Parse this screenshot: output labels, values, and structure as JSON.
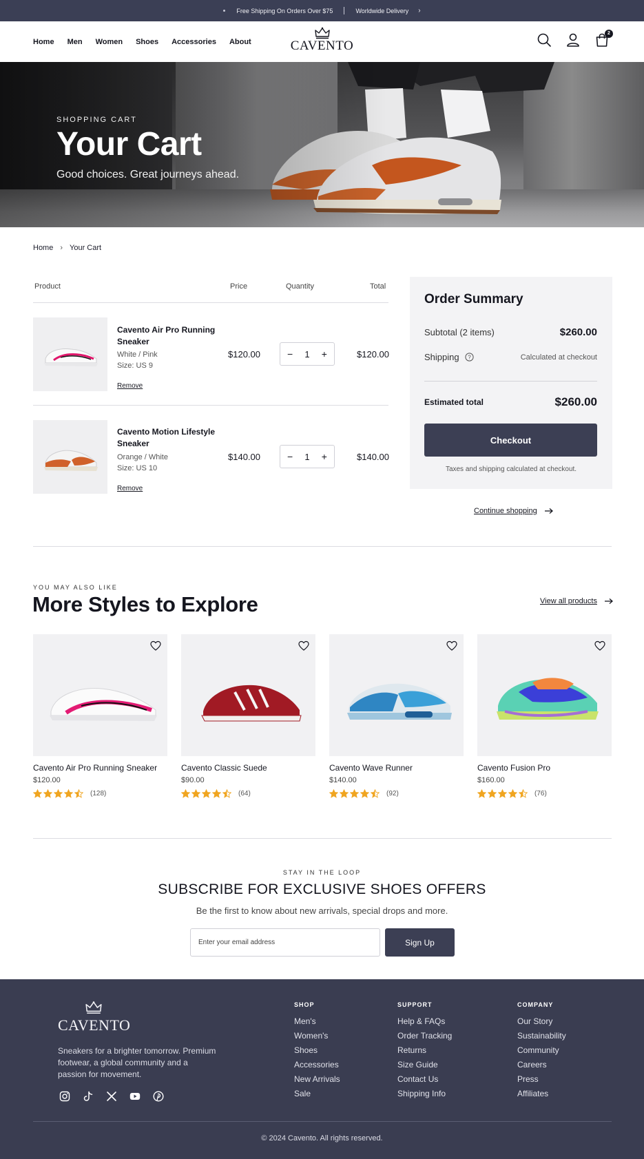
{
  "topbar": {
    "shipping_text": "Free Shipping On Orders Over $75",
    "delivery_text": "Worldwide Delivery"
  },
  "header": {
    "nav": [
      "Home",
      "Men",
      "Women",
      "Shoes",
      "Accessories",
      "About"
    ],
    "brand": "CAVENTO",
    "cart_count": "2",
    "icons": [
      "search-icon",
      "user-icon",
      "bag-icon"
    ]
  },
  "hero": {
    "eyebrow": "SHOPPING CART",
    "title": "Your Cart",
    "subtitle": "Good choices. Great journeys ahead."
  },
  "breadcrumb": {
    "home": "Home",
    "current": "Your Cart"
  },
  "cart": {
    "headers": {
      "product": "Product",
      "price": "Price",
      "quantity": "Quantity",
      "total": "Total"
    },
    "items": [
      {
        "name": "Cavento Air Pro Running Sneaker",
        "color": "White / Pink",
        "size": "Size: US 9",
        "price": "$120.00",
        "qty": "1",
        "total": "$120.00",
        "remove": "Remove"
      },
      {
        "name": "Cavento Motion Lifestyle Sneaker",
        "color": "Orange / White",
        "size": "Size: US 10",
        "price": "$140.00",
        "qty": "1",
        "total": "$140.00",
        "remove": "Remove"
      }
    ]
  },
  "summary": {
    "title": "Order Summary",
    "subtotal_label": "Subtotal (2 items)",
    "subtotal_value": "$260.00",
    "shipping_label": "Shipping",
    "shipping_value": "Calculated at checkout",
    "total_label": "Estimated total",
    "total_value": "$260.00",
    "checkout_label": "Checkout",
    "note": "Taxes and shipping calculated at checkout.",
    "continue_label": "Continue shopping"
  },
  "related": {
    "eyebrow": "YOU MAY ALSO LIKE",
    "title": "More Styles to Explore",
    "view_all": "View all products",
    "products": [
      {
        "name": "Cavento Air Pro Running Sneaker",
        "price": "$120.00",
        "rating": 4.5,
        "count": "(128)"
      },
      {
        "name": "Cavento Classic Suede",
        "price": "$90.00",
        "rating": 4.5,
        "count": "(64)"
      },
      {
        "name": "Cavento Wave Runner",
        "price": "$140.00",
        "rating": 4.5,
        "count": "(92)"
      },
      {
        "name": "Cavento Fusion Pro",
        "price": "$160.00",
        "rating": 4.5,
        "count": "(76)"
      }
    ]
  },
  "newsletter": {
    "eyebrow": "STAY IN THE LOOP",
    "title": "SUBSCRIBE FOR EXCLUSIVE SHOES OFFERS",
    "subtitle": "Be the first to know about new arrivals, special drops and more.",
    "placeholder": "Enter your email address",
    "button": "Sign Up"
  },
  "footer": {
    "brand": "CAVENTO",
    "tagline": "Sneakers for a brighter tomorrow. Premium footwear, a global community and a passion for movement.",
    "social": [
      "instagram-icon",
      "tiktok-icon",
      "x-icon",
      "youtube-icon",
      "pinterest-icon"
    ],
    "columns": [
      {
        "heading": "SHOP",
        "links": [
          "Men's",
          "Women's",
          "Shoes",
          "Accessories",
          "New Arrivals",
          "Sale"
        ]
      },
      {
        "heading": "SUPPORT",
        "links": [
          "Help & FAQs",
          "Order Tracking",
          "Returns",
          "Size Guide",
          "Contact Us",
          "Shipping Info"
        ]
      },
      {
        "heading": "COMPANY",
        "links": [
          "Our Story",
          "Sustainability",
          "Community",
          "Careers",
          "Press",
          "Affiliates"
        ]
      }
    ],
    "copyright": "© 2024 Cavento. All rights reserved."
  },
  "colors": {
    "dark": "#3a3d51",
    "accent_star": "#f0a520",
    "button": "#3c3f54"
  }
}
